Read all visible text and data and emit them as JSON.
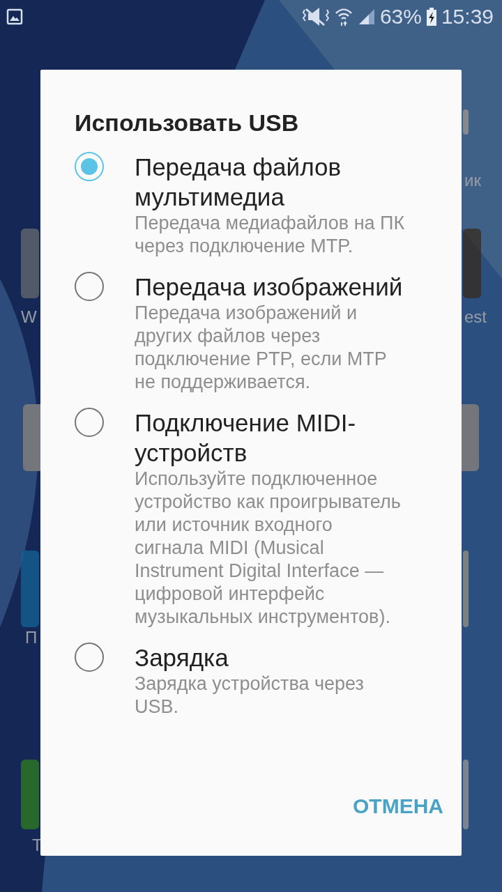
{
  "status_bar": {
    "battery": "63%",
    "time": "15:39"
  },
  "home_screen": {
    "labels": [
      "ик",
      "W",
      "est",
      "П",
      "Т"
    ]
  },
  "dialog": {
    "title": "Использовать USB",
    "options": [
      {
        "title": "Передача файлов мультимедиа",
        "description": "Передача медиафайлов на ПК через подключение MTP.",
        "selected": true
      },
      {
        "title": "Передача изображений",
        "description": "Передача изображений и других файлов через подключение PTP, если MTP не поддерживается.",
        "selected": false
      },
      {
        "title": "Подключение MIDI-устройств",
        "description": "Используйте подключенное устройство как проигрыватель или источник входного сигнала MIDI (Musical Instrument Digital Interface — цифровой интерфейс музыкальных инструментов).",
        "selected": false
      },
      {
        "title": "Зарядка",
        "description": "Зарядка устройства через USB.",
        "selected": false
      }
    ],
    "buttons": [
      "ОТМЕНА"
    ]
  }
}
